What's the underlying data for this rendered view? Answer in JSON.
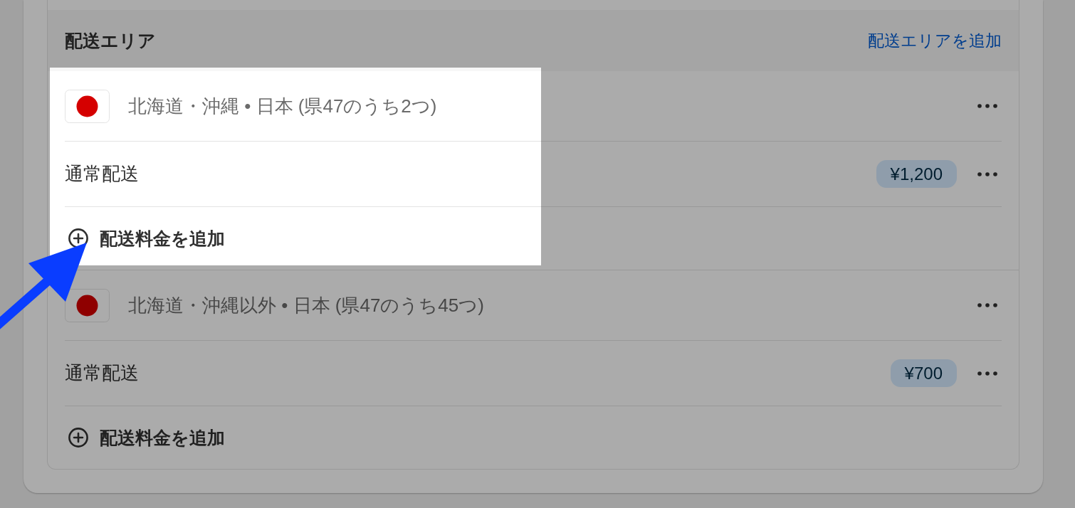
{
  "section": {
    "title": "配送エリア",
    "add_zone_link": "配送エリアを追加"
  },
  "zones": [
    {
      "name": "北海道・沖縄 • 日本 (県47のうち2つ)",
      "rates": [
        {
          "name": "通常配送",
          "price": "¥1,200"
        }
      ],
      "add_rate": "配送料金を追加"
    },
    {
      "name": "北海道・沖縄以外 • 日本 (県47のうち45つ)",
      "rates": [
        {
          "name": "通常配送",
          "price": "¥700"
        }
      ],
      "add_rate": "配送料金を追加"
    }
  ]
}
